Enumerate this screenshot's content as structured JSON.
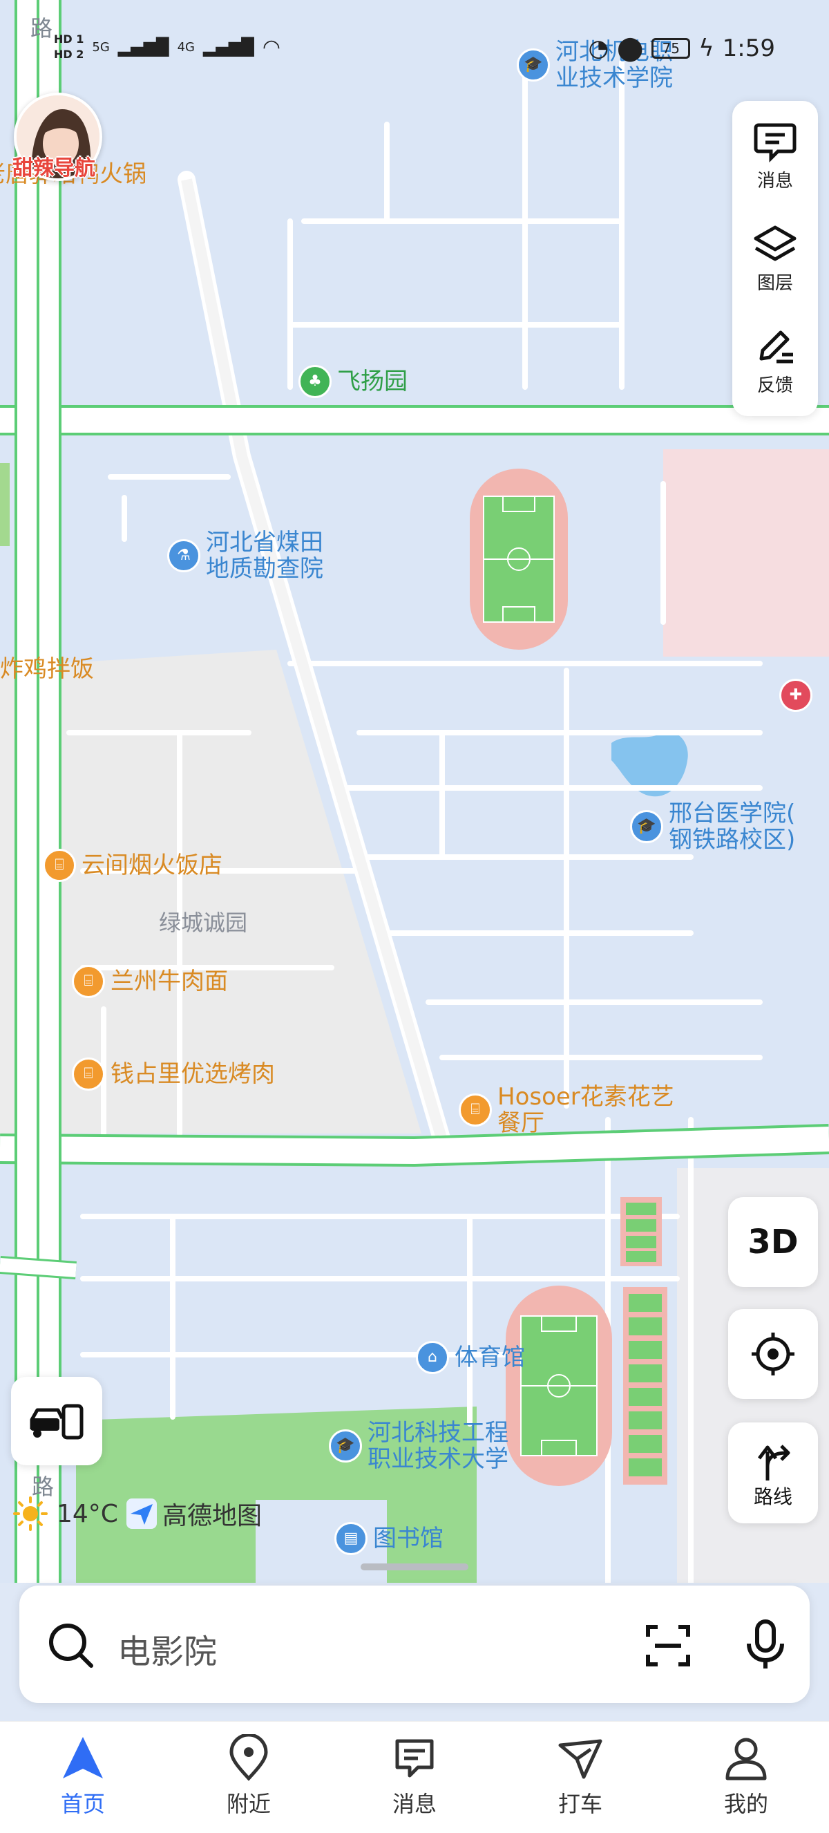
{
  "status_bar": {
    "hd1": "HD 1",
    "hd2": "HD 2",
    "net1": "5G",
    "net2": "4G",
    "battery": "75",
    "time": "1:59"
  },
  "avatar": {
    "caption": "甜辣导航"
  },
  "right_panel": {
    "messages": "消息",
    "layers": "图层",
    "feedback": "反馈"
  },
  "map": {
    "pois": [
      {
        "name": "河北机电职业技术学院",
        "line1": "河北机电职",
        "line2": "业技术学院",
        "type": "school"
      },
      {
        "name": "老唐驿站鸭火锅",
        "type": "restaurant"
      },
      {
        "name": "飞扬园",
        "type": "park"
      },
      {
        "name": "河北省煤田地质勘查院",
        "line1": "河北省煤田",
        "line2": "地质勘查院",
        "type": "research"
      },
      {
        "name": "炸鸡拌饭",
        "type": "restaurant"
      },
      {
        "name": "邢台医学院(钢铁路校区)",
        "line1": "邢台医学院(",
        "line2": "钢铁路校区)",
        "type": "school"
      },
      {
        "name": "云间烟火饭店",
        "type": "restaurant"
      },
      {
        "name": "兰州牛肉面",
        "type": "restaurant"
      },
      {
        "name": "钱占里优选烤肉",
        "type": "restaurant"
      },
      {
        "name": "Hosoer花素花艺餐厅",
        "line1": "Hosoer花素花艺",
        "line2": "餐厅",
        "type": "restaurant"
      },
      {
        "name": "体育馆",
        "type": "stadium"
      },
      {
        "name": "河北科技工程职业技术大学",
        "line1": "河北科技工程",
        "line2": "职业技术大学",
        "type": "school"
      },
      {
        "name": "图书馆",
        "type": "library"
      }
    ],
    "areas": [
      "绿城诚园"
    ],
    "road_labels": [
      "路",
      "路"
    ]
  },
  "controls": {
    "three_d": "3D",
    "route": "路线"
  },
  "weather": {
    "temp": "14°C",
    "brand": "高德地图"
  },
  "search": {
    "placeholder": "电影院"
  },
  "bottom_nav": [
    {
      "label": "首页",
      "icon": "navigation-arrow-icon",
      "active": true
    },
    {
      "label": "附近",
      "icon": "location-pin-icon",
      "active": false
    },
    {
      "label": "消息",
      "icon": "message-icon",
      "active": false
    },
    {
      "label": "打车",
      "icon": "taxi-icon",
      "active": false
    },
    {
      "label": "我的",
      "icon": "profile-icon",
      "active": false
    }
  ],
  "colors": {
    "accent": "#2f6df5",
    "map_bg": "#dbe6f6",
    "road_green": "#5ccd76",
    "poi_blue": "#3a86d0",
    "poi_orange": "#d98a23"
  }
}
